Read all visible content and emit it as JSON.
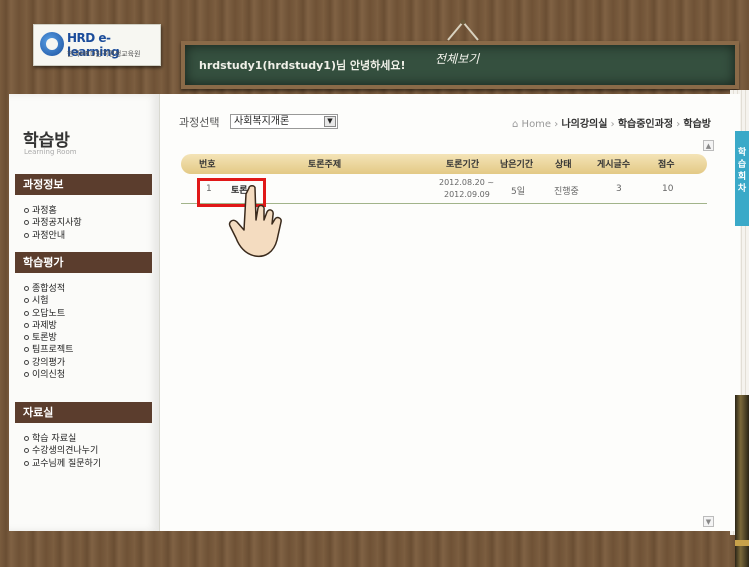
{
  "header": {
    "logo": {
      "title": "HRD e-learning",
      "subtitle": "한국HRD원격평생교육원"
    },
    "greeting": "hrdstudy1(hrdstudy1)님 안녕하세요!",
    "board_title": "전체보기"
  },
  "sidebar": {
    "title": "학습방",
    "subtitle": "Learning Room",
    "sections": [
      {
        "label": "과정정보",
        "items": [
          "과정홈",
          "과정공지사항",
          "과정안내"
        ]
      },
      {
        "label": "학습평가",
        "items": [
          "종합성적",
          "시험",
          "오답노트",
          "과제방",
          "토론방",
          "팀프로젝트",
          "강의평가",
          "이의신청"
        ]
      },
      {
        "label": "자료실",
        "items": [
          "학습 자료실",
          "수강생의견나누기",
          "교수님께 질문하기"
        ]
      }
    ]
  },
  "course_select": {
    "label": "과정선택",
    "value": "사회복지개론"
  },
  "breadcrumb": {
    "home": "Home",
    "items": [
      "나의강의실",
      "학습중인과정",
      "학습방"
    ]
  },
  "table": {
    "headers": [
      "번호",
      "토론주제",
      "토론기간",
      "남은기간",
      "상태",
      "게시글수",
      "점수"
    ],
    "rows": [
      {
        "no": "1",
        "topic": "토론",
        "period_start": "2012.08.20 ~",
        "period_end": "2012.09.09",
        "remaining": "5일",
        "status": "진행중",
        "posts": "3",
        "score": "10"
      }
    ]
  },
  "right_tab": "학습 회차",
  "colors": {
    "section_bg": "#5b3d2d",
    "table_header": "#e9d39a",
    "highlight": "#e01818",
    "board": "#35503f"
  }
}
